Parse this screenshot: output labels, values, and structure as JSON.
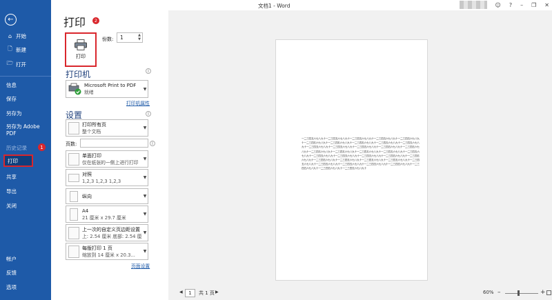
{
  "window": {
    "title": "文档1  -  Word"
  },
  "titlebar": {
    "smile_icon": "☺",
    "help": "?",
    "minimize": "–",
    "restore": "❐",
    "close": "✕"
  },
  "sidebar": {
    "items": [
      {
        "label": "开始",
        "icon": "home-icon"
      },
      {
        "label": "新建",
        "icon": "new-doc-icon"
      },
      {
        "label": "打开",
        "icon": "folder-open-icon"
      },
      {
        "label": "信息"
      },
      {
        "label": "保存"
      },
      {
        "label": "另存为"
      },
      {
        "label": "另存为 Adobe PDF"
      },
      {
        "label": "历史记录"
      },
      {
        "label": "打印"
      },
      {
        "label": "共享"
      },
      {
        "label": "导出"
      },
      {
        "label": "关闭"
      },
      {
        "label": "帐户"
      },
      {
        "label": "反馈"
      },
      {
        "label": "选项"
      }
    ],
    "history_badge": "1"
  },
  "print": {
    "title": "打印",
    "title_badge": "2",
    "button_label": "打印",
    "copies_label": "份数:",
    "copies_value": "1"
  },
  "printer": {
    "heading": "打印机",
    "name": "Microsoft Print to PDF",
    "status": "就绪",
    "properties_link": "打印机属性"
  },
  "settings": {
    "heading": "设置",
    "range_main": "打印所有页",
    "range_sub": "整个文档",
    "pages_label": "页数:",
    "pages_value": "",
    "sides_main": "单面打印",
    "sides_sub": "仅在纸张的一侧上进行打印",
    "collate_main": "对照",
    "collate_sub": "1,2,3     1,2,3     1,2,3",
    "orientation": "纵向",
    "paper_main": "A4",
    "paper_sub": "21 厘米 x 29.7 厘米",
    "margins_main": "上一次的自定义页边距设置",
    "margins_sub": "上: 2.54 厘米 底部: 2.54 厘米",
    "perpage_main": "每版打印 1 页",
    "perpage_sub": "缩放到 14 厘米 x 20.3...",
    "page_setup_link": "页面设置"
  },
  "preview": {
    "text": "一二三四五六七八九十一二三四五六七八九十一二三四五六七八九十一二三四五六七八九十一二三四五六七八九十一二三四五六七八九十一二三四五六七八九十一二三四五六七八九十一二三四五六七八九十一二三四五六七八九十一二三四五六七八九十一二三四五六七八九十一二三四五六七八九十一二三四五六七八九十一二三四五六七八九十一二三四五六七八九十一二三四五六七八九十一二三四五六七八九十一二三四五六七八九十一二三四五六七八九十一二三四五六七八九十一二三四五六七八九十一二三四五六七八九十一二三四五六七八九十一二三四五六七八九十一二三四五六七八九十一二三四五六七八九十一二三四五六七八九十一二三四五六七八九十一二三四五六七八九十一二三四五六七八九十一二三四五六七八九十一二三四五六七八九十一二三四五六七八九十一二三四五六七八九十一二三四五六七八九十一二三四五六七八九十"
  },
  "status": {
    "current_page": "1",
    "total_pages": "共 1 页",
    "zoom": "60%",
    "zoom_fraction": 0.4
  }
}
